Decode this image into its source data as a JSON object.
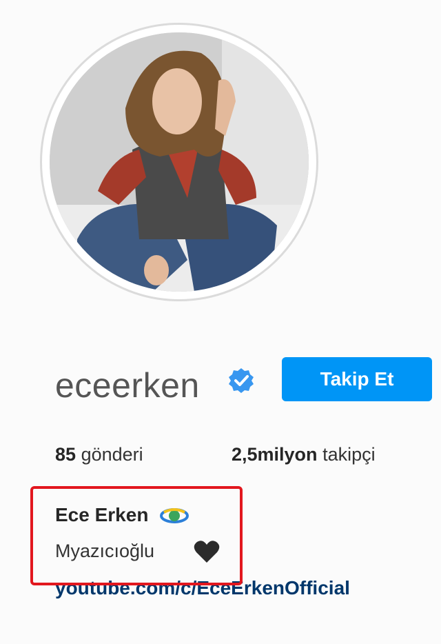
{
  "profile": {
    "username": "eceerken",
    "full_name": "Ece Erken",
    "bio_line": "Myazıcıoğlu",
    "link": "youtube.com/c/EceErkenOfficial",
    "verified": true
  },
  "actions": {
    "follow_label": "Takip Et"
  },
  "stats": {
    "posts_count": "85",
    "posts_label": "gönderi",
    "followers_count": "2,5milyon",
    "followers_label": "takipçi"
  },
  "icons": {
    "verified": "verified-badge-icon",
    "bio_heart": "black-heart-icon",
    "name_emoji": "orbit-emoji-icon"
  },
  "colors": {
    "follow_button": "#0095f6",
    "verified_badge": "#3897f0",
    "link": "#00376b",
    "highlight_box": "#e2171e"
  }
}
